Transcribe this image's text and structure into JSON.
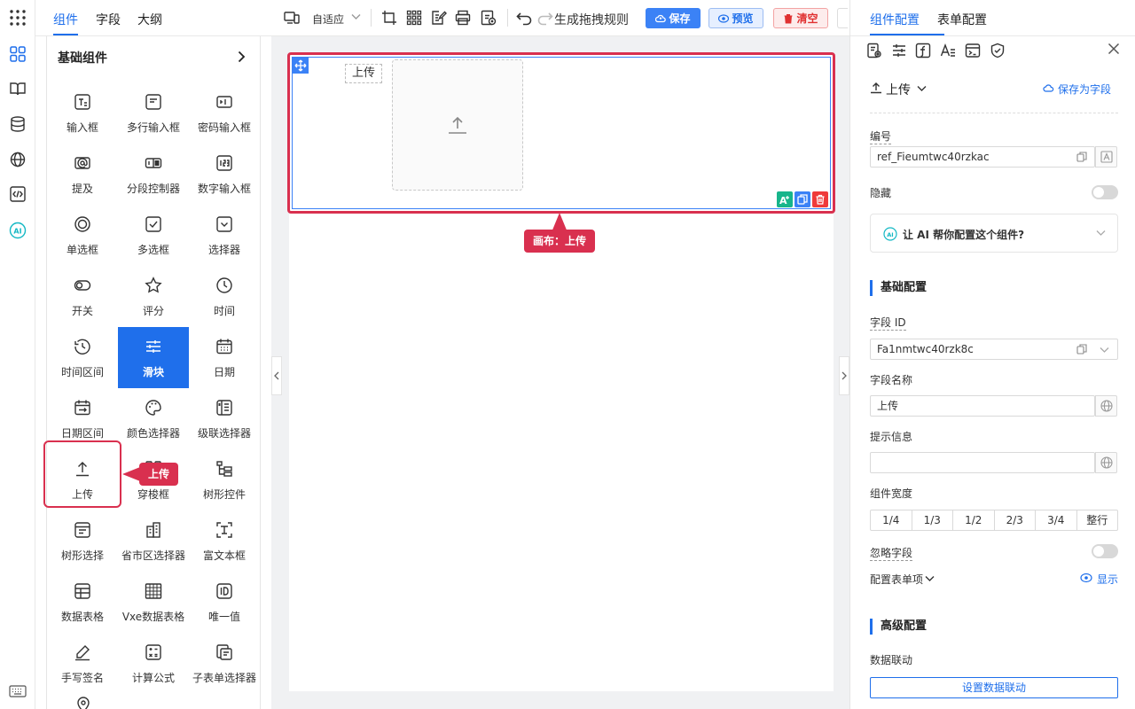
{
  "left_panel": {
    "tabs": [
      {
        "label": "组件",
        "active": true
      },
      {
        "label": "字段",
        "active": false
      },
      {
        "label": "大纲",
        "active": false
      }
    ],
    "title": "基础组件",
    "components": [
      {
        "label": "输入框",
        "icon": "text-input-icon"
      },
      {
        "label": "多行输入框",
        "icon": "textarea-icon"
      },
      {
        "label": "密码输入框",
        "icon": "password-input-icon"
      },
      {
        "label": "提及",
        "icon": "mention-icon"
      },
      {
        "label": "分段控制器",
        "icon": "segmented-icon"
      },
      {
        "label": "数字输入框",
        "icon": "number-input-icon"
      },
      {
        "label": "单选框",
        "icon": "radio-icon"
      },
      {
        "label": "多选框",
        "icon": "checkbox-icon"
      },
      {
        "label": "选择器",
        "icon": "select-icon"
      },
      {
        "label": "开关",
        "icon": "switch-icon"
      },
      {
        "label": "评分",
        "icon": "star-icon"
      },
      {
        "label": "时间",
        "icon": "clock-icon"
      },
      {
        "label": "时间区间",
        "icon": "time-range-icon"
      },
      {
        "label": "滑块",
        "icon": "slider-icon",
        "selected": true
      },
      {
        "label": "日期",
        "icon": "calendar-icon"
      },
      {
        "label": "日期区间",
        "icon": "date-range-icon"
      },
      {
        "label": "颜色选择器",
        "icon": "palette-icon"
      },
      {
        "label": "级联选择器",
        "icon": "cascader-icon"
      },
      {
        "label": "上传",
        "icon": "upload-icon"
      },
      {
        "label": "穿梭框",
        "icon": "transfer-icon"
      },
      {
        "label": "树形控件",
        "icon": "tree-icon"
      },
      {
        "label": "树形选择",
        "icon": "tree-select-icon"
      },
      {
        "label": "省市区选择器",
        "icon": "region-icon"
      },
      {
        "label": "富文本框",
        "icon": "richtext-icon"
      },
      {
        "label": "数据表格",
        "icon": "table-icon"
      },
      {
        "label": "Vxe数据表格",
        "icon": "vxe-table-icon"
      },
      {
        "label": "唯一值",
        "icon": "id-icon"
      },
      {
        "label": "手写签名",
        "icon": "pen-icon"
      },
      {
        "label": "计算公式",
        "icon": "calculator-icon"
      },
      {
        "label": "子表单选择器",
        "icon": "subform-icon"
      }
    ],
    "drag_tooltip": "上传"
  },
  "toolbar": {
    "layout_select": "自适应",
    "redo_label": "生成拖拽规则",
    "save_label": "保存",
    "preview_label": "预览",
    "clear_label": "清空"
  },
  "canvas": {
    "field_label": "上传",
    "tooltip": "画布：上传"
  },
  "right_panel": {
    "tabs": [
      {
        "label": "组件配置",
        "active": true
      },
      {
        "label": "表单配置",
        "active": false
      }
    ],
    "component_name": "上传",
    "save_as_field": "保存为字段",
    "ref_label": "编号",
    "ref_value": "ref_Fieumtwc40rzkac",
    "hidden_label": "隐藏",
    "ai_prompt": "让 AI 帮你配置这个组件?",
    "basic_section": "基础配置",
    "field_id_label": "字段 ID",
    "field_id_value": "Fa1nmtwc40rzk8c",
    "field_name_label": "字段名称",
    "field_name_value": "上传",
    "hint_label": "提示信息",
    "hint_value": "",
    "width_label": "组件宽度",
    "width_options": [
      "1/4",
      "1/3",
      "1/2",
      "2/3",
      "3/4",
      "整行"
    ],
    "ignore_label": "忽略字段",
    "form_items_label": "配置表单项",
    "show_label": "显示",
    "advanced_section": "高级配置",
    "linkage_label": "数据联动",
    "linkage_button": "设置数据联动"
  },
  "colors": {
    "accent": "#1f6feb",
    "highlight": "#d9304f",
    "danger": "#e03030"
  }
}
